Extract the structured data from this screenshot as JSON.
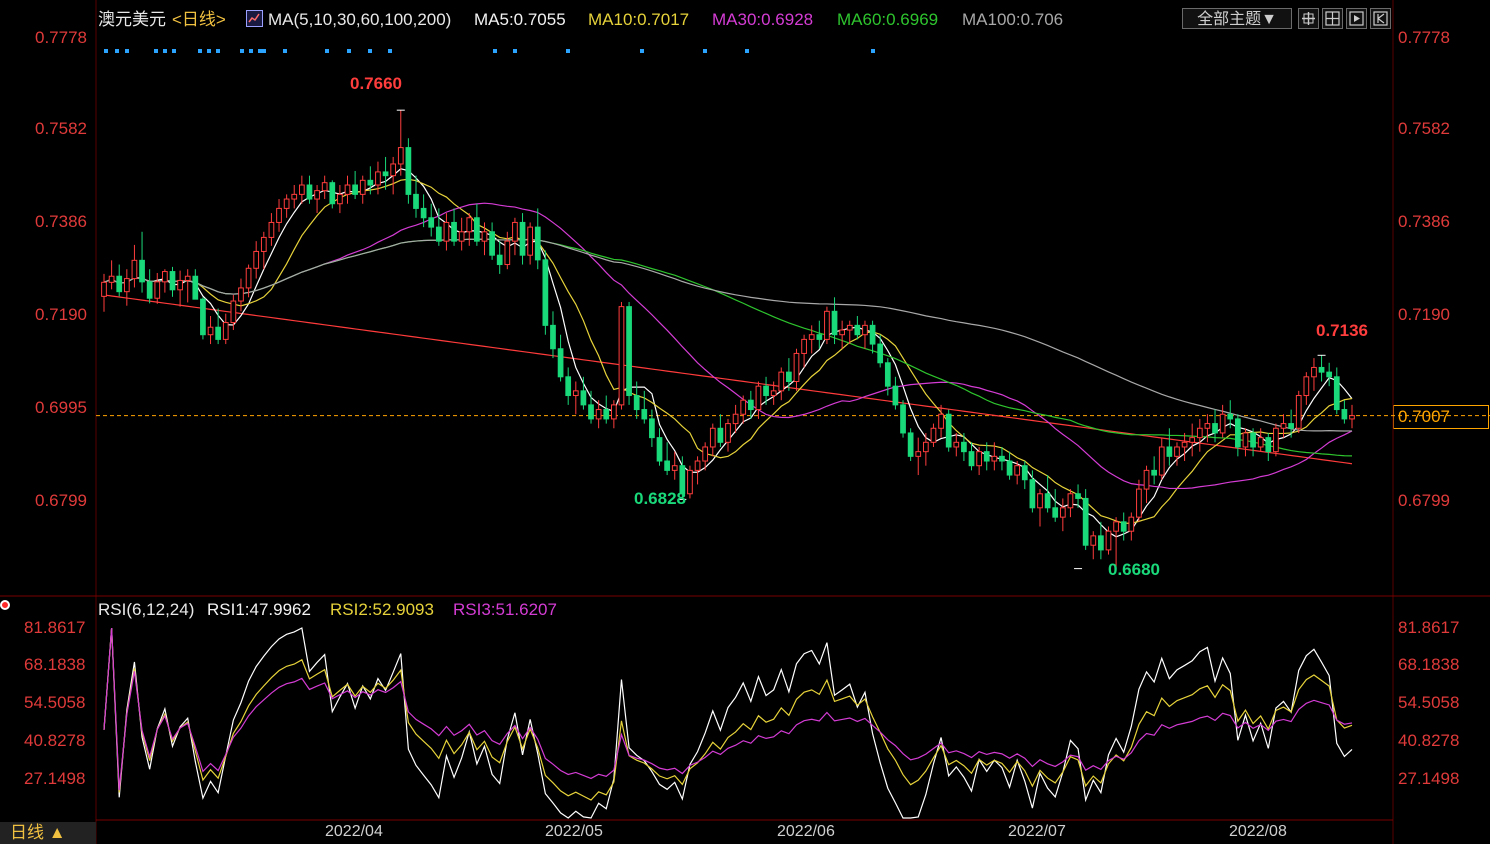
{
  "header": {
    "symbol": "澳元美元",
    "period": "<日线>",
    "ma_label": "MA(5,10,30,60,100,200)",
    "ma5": "MA5:0.7055",
    "ma10": "MA10:0.7017",
    "ma30": "MA30:0.6928",
    "ma60": "MA60:0.6969",
    "ma100": "MA100:0.706",
    "theme_button": "全部主题▼"
  },
  "price_axis": {
    "labels": [
      "0.7778",
      "0.7582",
      "0.7386",
      "0.7190",
      "0.6995",
      "0.6799"
    ]
  },
  "price_axis_right": {
    "labels": [
      "0.7778",
      "0.7582",
      "0.7386",
      "0.7190",
      "0.6995",
      "0.6799"
    ],
    "current_price": "0.7007"
  },
  "extremes": {
    "high": "0.7660",
    "local_low1": "0.6828",
    "low": "0.6680",
    "recent_high": "0.7136"
  },
  "rsi": {
    "label": "RSI(6,12,24)",
    "rsi1": "RSI1:47.9962",
    "rsi2": "RSI2:52.9093",
    "rsi3": "RSI3:51.6207",
    "axis_labels": [
      "81.8617",
      "68.1838",
      "54.5058",
      "40.8278",
      "27.1498"
    ]
  },
  "time_axis": {
    "period_button": "日线 ▲",
    "dates": [
      "2022/04",
      "2022/05",
      "2022/06",
      "2022/07",
      "2022/08"
    ]
  },
  "colors": {
    "up": "#ff3d3d",
    "down": "#19d97a",
    "ma5": "#ffffff",
    "ma10": "#e6d23a",
    "ma30": "#d43cd4",
    "ma60": "#2ec42e",
    "ma100": "#a8a8a8",
    "ma200": "#ff3b3b",
    "axis_red": "#e03a3a",
    "current_line": "#ffa500"
  },
  "chart_data": {
    "type": "candlestick",
    "series": [
      {
        "name": "澳元美元",
        "ohlc": [
          [
            0.7262,
            0.731,
            0.7229,
            0.7292
          ],
          [
            0.7292,
            0.7339,
            0.7277,
            0.7305
          ],
          [
            0.7305,
            0.733,
            0.7262,
            0.7272
          ],
          [
            0.7272,
            0.732,
            0.7242,
            0.73
          ],
          [
            0.73,
            0.7372,
            0.7281,
            0.7339
          ],
          [
            0.7339,
            0.74,
            0.727,
            0.7293
          ],
          [
            0.7293,
            0.732,
            0.7247,
            0.7258
          ],
          [
            0.7258,
            0.7312,
            0.7246,
            0.7293
          ],
          [
            0.7293,
            0.732,
            0.727,
            0.7315
          ],
          [
            0.7315,
            0.7325,
            0.7261,
            0.7276
          ],
          [
            0.7276,
            0.7317,
            0.724,
            0.7296
          ],
          [
            0.7296,
            0.732,
            0.7249,
            0.7305
          ],
          [
            0.7305,
            0.732,
            0.7256,
            0.7256
          ],
          [
            0.7256,
            0.726,
            0.717,
            0.718
          ],
          [
            0.718,
            0.722,
            0.716,
            0.7196
          ],
          [
            0.7196,
            0.7236,
            0.716,
            0.717
          ],
          [
            0.717,
            0.7225,
            0.716,
            0.7206
          ],
          [
            0.7206,
            0.7265,
            0.719,
            0.7252
          ],
          [
            0.7252,
            0.73,
            0.723,
            0.728
          ],
          [
            0.728,
            0.733,
            0.726,
            0.7322
          ],
          [
            0.7322,
            0.738,
            0.73,
            0.7358
          ],
          [
            0.7358,
            0.74,
            0.732,
            0.7388
          ],
          [
            0.7388,
            0.744,
            0.737,
            0.742
          ],
          [
            0.742,
            0.747,
            0.74,
            0.745
          ],
          [
            0.745,
            0.748,
            0.743,
            0.747
          ],
          [
            0.747,
            0.75,
            0.745,
            0.748
          ],
          [
            0.748,
            0.752,
            0.746,
            0.75
          ],
          [
            0.75,
            0.752,
            0.746,
            0.747
          ],
          [
            0.747,
            0.75,
            0.744,
            0.7488
          ],
          [
            0.7488,
            0.752,
            0.747,
            0.7505
          ],
          [
            0.7505,
            0.751,
            0.745,
            0.746
          ],
          [
            0.746,
            0.75,
            0.744,
            0.748
          ],
          [
            0.748,
            0.752,
            0.746,
            0.75
          ],
          [
            0.75,
            0.753,
            0.747,
            0.748
          ],
          [
            0.748,
            0.752,
            0.746,
            0.751
          ],
          [
            0.751,
            0.754,
            0.748,
            0.75
          ],
          [
            0.75,
            0.755,
            0.748,
            0.7528
          ],
          [
            0.7528,
            0.756,
            0.749,
            0.752
          ],
          [
            0.752,
            0.756,
            0.748,
            0.7545
          ],
          [
            0.7545,
            0.766,
            0.752,
            0.758
          ],
          [
            0.758,
            0.76,
            0.746,
            0.748
          ],
          [
            0.748,
            0.752,
            0.743,
            0.745
          ],
          [
            0.745,
            0.748,
            0.741,
            0.743
          ],
          [
            0.743,
            0.746,
            0.739,
            0.741
          ],
          [
            0.741,
            0.745,
            0.737,
            0.738
          ],
          [
            0.738,
            0.744,
            0.736,
            0.742
          ],
          [
            0.742,
            0.745,
            0.737,
            0.738
          ],
          [
            0.738,
            0.743,
            0.736,
            0.74
          ],
          [
            0.74,
            0.744,
            0.737,
            0.743
          ],
          [
            0.743,
            0.746,
            0.737,
            0.738
          ],
          [
            0.738,
            0.742,
            0.735,
            0.74
          ],
          [
            0.74,
            0.742,
            0.734,
            0.735
          ],
          [
            0.735,
            0.738,
            0.731,
            0.733
          ],
          [
            0.733,
            0.74,
            0.732,
            0.738
          ],
          [
            0.738,
            0.743,
            0.735,
            0.742
          ],
          [
            0.742,
            0.744,
            0.733,
            0.735
          ],
          [
            0.735,
            0.742,
            0.733,
            0.741
          ],
          [
            0.741,
            0.745,
            0.732,
            0.734
          ],
          [
            0.734,
            0.736,
            0.718,
            0.72
          ],
          [
            0.72,
            0.723,
            0.713,
            0.715
          ],
          [
            0.715,
            0.718,
            0.708,
            0.709
          ],
          [
            0.709,
            0.711,
            0.703,
            0.705
          ],
          [
            0.705,
            0.708,
            0.701,
            0.706
          ],
          [
            0.706,
            0.709,
            0.702,
            0.703
          ],
          [
            0.703,
            0.706,
            0.699,
            0.7
          ],
          [
            0.7,
            0.704,
            0.698,
            0.702
          ],
          [
            0.702,
            0.705,
            0.699,
            0.7
          ],
          [
            0.7,
            0.704,
            0.698,
            0.703
          ],
          [
            0.703,
            0.725,
            0.702,
            0.724
          ],
          [
            0.724,
            0.725,
            0.703,
            0.705
          ],
          [
            0.705,
            0.708,
            0.7,
            0.702
          ],
          [
            0.702,
            0.706,
            0.699,
            0.7
          ],
          [
            0.7,
            0.702,
            0.694,
            0.696
          ],
          [
            0.696,
            0.698,
            0.69,
            0.691
          ],
          [
            0.691,
            0.695,
            0.688,
            0.689
          ],
          [
            0.689,
            0.693,
            0.687,
            0.69
          ],
          [
            0.69,
            0.692,
            0.6828,
            0.684
          ],
          [
            0.684,
            0.69,
            0.683,
            0.689
          ],
          [
            0.689,
            0.692,
            0.686,
            0.691
          ],
          [
            0.691,
            0.695,
            0.689,
            0.694
          ],
          [
            0.694,
            0.699,
            0.692,
            0.698
          ],
          [
            0.698,
            0.701,
            0.694,
            0.695
          ],
          [
            0.695,
            0.7,
            0.693,
            0.699
          ],
          [
            0.699,
            0.703,
            0.697,
            0.701
          ],
          [
            0.701,
            0.705,
            0.699,
            0.704
          ],
          [
            0.704,
            0.706,
            0.7,
            0.702
          ],
          [
            0.702,
            0.708,
            0.7,
            0.707
          ],
          [
            0.707,
            0.709,
            0.703,
            0.705
          ],
          [
            0.705,
            0.708,
            0.703,
            0.706
          ],
          [
            0.706,
            0.711,
            0.704,
            0.71
          ],
          [
            0.71,
            0.713,
            0.706,
            0.708
          ],
          [
            0.708,
            0.715,
            0.706,
            0.714
          ],
          [
            0.714,
            0.718,
            0.711,
            0.717
          ],
          [
            0.717,
            0.72,
            0.714,
            0.718
          ],
          [
            0.718,
            0.721,
            0.715,
            0.717
          ],
          [
            0.717,
            0.724,
            0.716,
            0.723
          ],
          [
            0.723,
            0.726,
            0.716,
            0.718
          ],
          [
            0.718,
            0.721,
            0.715,
            0.719
          ],
          [
            0.719,
            0.721,
            0.716,
            0.72
          ],
          [
            0.72,
            0.722,
            0.717,
            0.718
          ],
          [
            0.718,
            0.721,
            0.715,
            0.72
          ],
          [
            0.72,
            0.721,
            0.714,
            0.716
          ],
          [
            0.716,
            0.718,
            0.711,
            0.712
          ],
          [
            0.712,
            0.713,
            0.705,
            0.707
          ],
          [
            0.707,
            0.709,
            0.702,
            0.703
          ],
          [
            0.703,
            0.704,
            0.696,
            0.697
          ],
          [
            0.697,
            0.698,
            0.691,
            0.692
          ],
          [
            0.692,
            0.696,
            0.688,
            0.693
          ],
          [
            0.693,
            0.697,
            0.69,
            0.695
          ],
          [
            0.695,
            0.699,
            0.694,
            0.698
          ],
          [
            0.698,
            0.703,
            0.696,
            0.701
          ],
          [
            0.701,
            0.702,
            0.693,
            0.694
          ],
          [
            0.694,
            0.697,
            0.692,
            0.695
          ],
          [
            0.695,
            0.697,
            0.691,
            0.693
          ],
          [
            0.693,
            0.695,
            0.689,
            0.69
          ],
          [
            0.69,
            0.694,
            0.688,
            0.693
          ],
          [
            0.693,
            0.695,
            0.689,
            0.691
          ],
          [
            0.691,
            0.695,
            0.689,
            0.692
          ],
          [
            0.692,
            0.694,
            0.689,
            0.691
          ],
          [
            0.691,
            0.693,
            0.687,
            0.688
          ],
          [
            0.688,
            0.691,
            0.686,
            0.69
          ],
          [
            0.69,
            0.691,
            0.685,
            0.687
          ],
          [
            0.687,
            0.689,
            0.68,
            0.681
          ],
          [
            0.681,
            0.685,
            0.677,
            0.684
          ],
          [
            0.684,
            0.688,
            0.68,
            0.681
          ],
          [
            0.681,
            0.685,
            0.678,
            0.679
          ],
          [
            0.679,
            0.683,
            0.676,
            0.681
          ],
          [
            0.681,
            0.685,
            0.679,
            0.684
          ],
          [
            0.684,
            0.686,
            0.681,
            0.683
          ],
          [
            0.683,
            0.685,
            0.672,
            0.673
          ],
          [
            0.673,
            0.676,
            0.67,
            0.675
          ],
          [
            0.675,
            0.678,
            0.67,
            0.672
          ],
          [
            0.672,
            0.677,
            0.671,
            0.676
          ],
          [
            0.676,
            0.679,
            0.668,
            0.678
          ],
          [
            0.678,
            0.68,
            0.674,
            0.676
          ],
          [
            0.676,
            0.68,
            0.674,
            0.679
          ],
          [
            0.679,
            0.687,
            0.678,
            0.685
          ],
          [
            0.685,
            0.69,
            0.682,
            0.689
          ],
          [
            0.689,
            0.692,
            0.686,
            0.688
          ],
          [
            0.688,
            0.696,
            0.687,
            0.694
          ],
          [
            0.694,
            0.698,
            0.69,
            0.692
          ],
          [
            0.692,
            0.695,
            0.69,
            0.694
          ],
          [
            0.694,
            0.697,
            0.691,
            0.695
          ],
          [
            0.695,
            0.699,
            0.692,
            0.696
          ],
          [
            0.696,
            0.7,
            0.693,
            0.698
          ],
          [
            0.698,
            0.701,
            0.695,
            0.699
          ],
          [
            0.699,
            0.702,
            0.695,
            0.697
          ],
          [
            0.697,
            0.703,
            0.696,
            0.701
          ],
          [
            0.701,
            0.704,
            0.698,
            0.7
          ],
          [
            0.7,
            0.701,
            0.692,
            0.694
          ],
          [
            0.694,
            0.698,
            0.692,
            0.697
          ],
          [
            0.697,
            0.698,
            0.692,
            0.694
          ],
          [
            0.694,
            0.698,
            0.693,
            0.696
          ],
          [
            0.696,
            0.697,
            0.691,
            0.693
          ],
          [
            0.693,
            0.699,
            0.692,
            0.698
          ],
          [
            0.698,
            0.701,
            0.696,
            0.699
          ],
          [
            0.699,
            0.702,
            0.696,
            0.698
          ],
          [
            0.698,
            0.706,
            0.697,
            0.705
          ],
          [
            0.705,
            0.71,
            0.703,
            0.709
          ],
          [
            0.709,
            0.713,
            0.706,
            0.711
          ],
          [
            0.711,
            0.7136,
            0.708,
            0.71
          ],
          [
            0.71,
            0.712,
            0.707,
            0.709
          ],
          [
            0.709,
            0.711,
            0.701,
            0.702
          ],
          [
            0.702,
            0.704,
            0.699,
            0.7
          ],
          [
            0.7,
            0.703,
            0.698,
            0.7007
          ]
        ]
      }
    ],
    "x_dates": [
      "2022/04",
      "2022/05",
      "2022/06",
      "2022/07",
      "2022/08"
    ],
    "ylim": [
      0.663,
      0.781
    ],
    "annotations": [
      "0.7660",
      "0.6828",
      "0.6680",
      "0.7136"
    ],
    "rsi_ylim": [
      17,
      88
    ]
  }
}
